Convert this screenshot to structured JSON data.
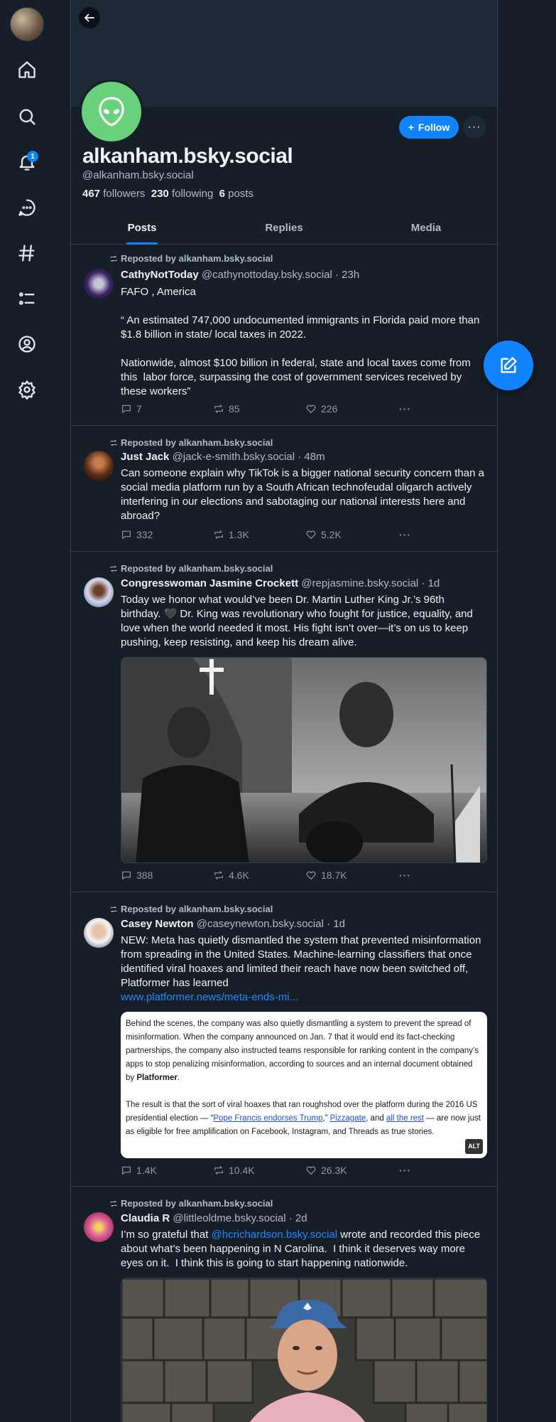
{
  "colors": {
    "accent": "#1083fe",
    "background": "#161e27",
    "avatar_green": "#6ad27c"
  },
  "nav": {
    "items": [
      {
        "name": "home",
        "icon": "home-icon"
      },
      {
        "name": "search",
        "icon": "search-icon"
      },
      {
        "name": "notifications",
        "icon": "bell-icon",
        "badge": "1"
      },
      {
        "name": "chat",
        "icon": "chat-icon"
      },
      {
        "name": "feeds",
        "icon": "hash-icon"
      },
      {
        "name": "lists",
        "icon": "list-icon"
      },
      {
        "name": "profile",
        "icon": "user-circle-icon"
      },
      {
        "name": "settings",
        "icon": "gear-icon"
      }
    ]
  },
  "profile": {
    "display_name": "alkanham.bsky.social",
    "handle": "@alkanham.bsky.social",
    "followers_count": "467",
    "followers_label": "followers",
    "following_count": "230",
    "following_label": "following",
    "posts_count": "6",
    "posts_label": "posts",
    "follow_label": "Follow",
    "more_label": "···"
  },
  "tabs": [
    "Posts",
    "Replies",
    "Media"
  ],
  "posts": [
    {
      "repost_label": "Reposted by alkanham.bsky.social",
      "author": "CathyNotToday",
      "meta": "@cathynottoday.bsky.social · 23h",
      "text": "FAFO , America\n\n“ An estimated 747,000 undocumented immigrants in Florida paid more than $1.8 billion in state/ local taxes in 2022.\n\nNationwide, almost $100 billion in federal, state and local taxes come from this  labor force, surpassing the cost of government services received by these workers”",
      "replies": "7",
      "reposts": "85",
      "likes": "226"
    },
    {
      "repost_label": "Reposted by alkanham.bsky.social",
      "author": "Just Jack",
      "meta": "@jack-e-smith.bsky.social · 48m",
      "text": "Can someone explain why TikTok is a bigger national security concern than a social media platform run by a South African technofeudal oligarch actively interfering in our elections and sabotaging our national interests here and abroad?",
      "replies": "332",
      "reposts": "1.3K",
      "likes": "5.2K"
    },
    {
      "repost_label": "Reposted by alkanham.bsky.social",
      "author": "Congresswoman Jasmine Crockett",
      "meta": "@repjasmine.bsky.social · 1d",
      "text": "Today we honor what would’ve been Dr. Martin Luther King Jr.’s 96th birthday. 🖤 Dr. King was revolutionary who fought for justice, equality, and love when the world needed it most. His fight isn’t over—it’s on us to keep pushing, keep resisting, and keep his dream alive.",
      "replies": "388",
      "reposts": "4.6K",
      "likes": "18.7K"
    },
    {
      "repost_label": "Reposted by alkanham.bsky.social",
      "author": "Casey Newton",
      "meta": "@caseynewton.bsky.social · 1d",
      "text": "NEW: Meta has quietly dismantled the system that prevented misinformation from spreading in the United States. Machine-learning classifiers that once identified viral hoaxes and limited their reach have now been switched off, Platformer has learned",
      "link": "www.platformer.news/meta-ends-mi...",
      "quote_p1": "Behind the scenes, the company was also quietly dismantling a system to prevent the spread of misinformation. When the company announced on Jan. 7 that it would end its fact-checking partnerships, the company also instructed teams responsible for ranking content in the company’s apps to stop penalizing misinformation, according to sources and an internal document obtained by",
      "quote_bold": "Platformer",
      "quote_p2_a": "The result is that the sort of viral hoaxes that ran roughshod over the platform during the 2016 US presidential election — “",
      "quote_link1": "Pope Francis endorses Trump",
      "quote_p2_b": ",” ",
      "quote_link2": "Pizzagate",
      "quote_p2_c": ", and ",
      "quote_link3": "all the rest",
      "quote_p2_d": " — are now just as eligible for free amplification on Facebook, Instagram, and Threads as true stories.",
      "alt": "ALT",
      "replies": "1.4K",
      "reposts": "10.4K",
      "likes": "26.3K"
    },
    {
      "repost_label": "Reposted by alkanham.bsky.social",
      "author": "Claudia R",
      "meta": "@littleoldme.bsky.social · 2d",
      "text_before": "I’m so grateful that ",
      "mention": "@hcrichardson.bsky.social",
      "text_after": " wrote and recorded this piece about what’s been happening in N Carolina.  I think it deserves way more eyes on it.  I think this is going to start happening nationwide."
    }
  ]
}
